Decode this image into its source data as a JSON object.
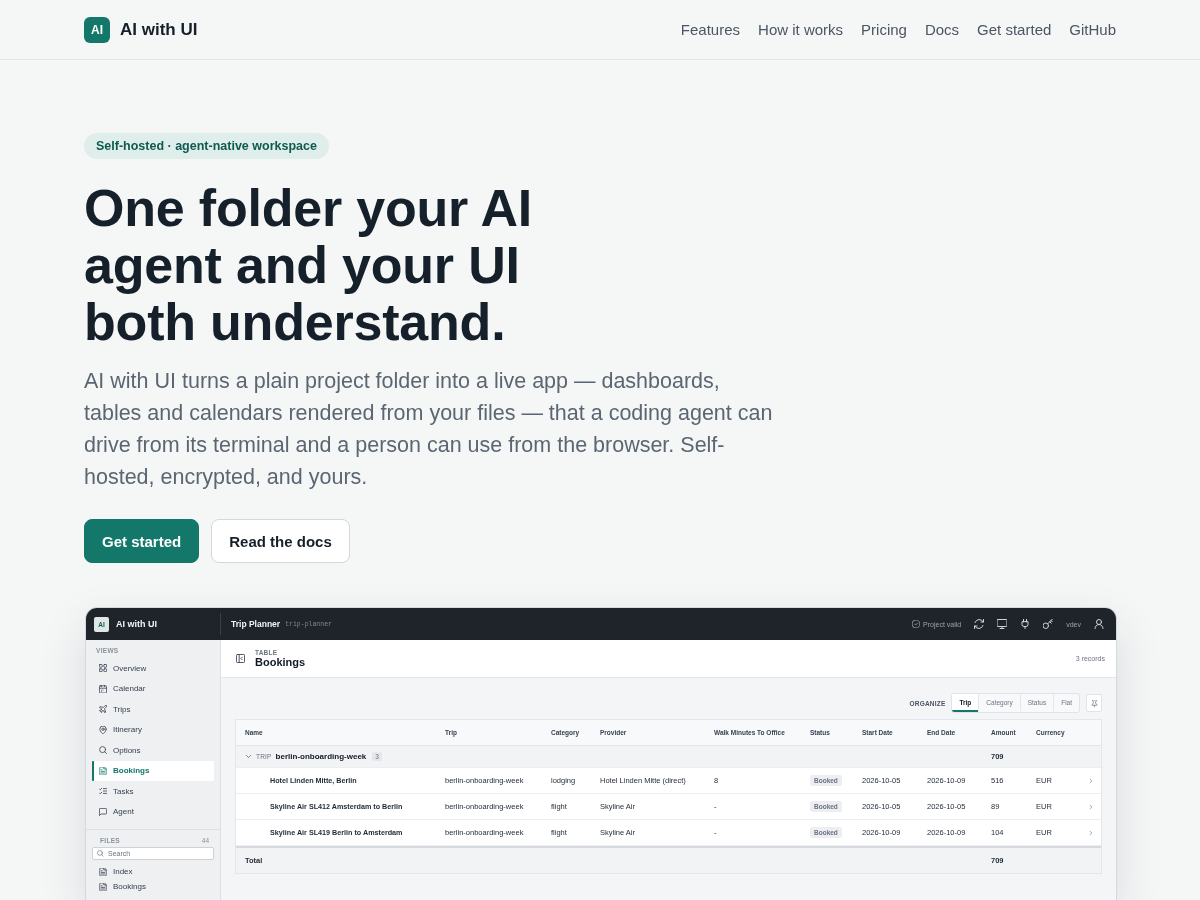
{
  "nav": {
    "logo": "AI",
    "brand": "AI with UI",
    "links": [
      "Features",
      "How it works",
      "Pricing",
      "Docs",
      "Get started",
      "GitHub"
    ]
  },
  "hero": {
    "badge": "Self-hosted · agent-native workspace",
    "headline": "One folder your AI agent and your UI both understand.",
    "description": "AI with UI turns a plain project folder into a live app — dashboards, tables and calendars rendered from your files — that a coding agent can drive from its terminal and a person can use from the browser. Self-hosted, encrypted, and yours.",
    "buttons": [
      {
        "label": "Get started",
        "kind": "primary"
      },
      {
        "label": "Read the docs",
        "kind": "secondary"
      }
    ]
  },
  "app_preview": {
    "header": {
      "logo": "AI",
      "brand": "AI with UI",
      "project": "Trip Planner",
      "project_slug": "trip-planner",
      "status": "Project valid",
      "user": "vdev"
    },
    "sidebar": {
      "views_label": "VIEWS",
      "views": [
        {
          "label": "Overview",
          "selected": false
        },
        {
          "label": "Calendar",
          "selected": false
        },
        {
          "label": "Trips",
          "selected": false
        },
        {
          "label": "Itinerary",
          "selected": false
        },
        {
          "label": "Options",
          "selected": false
        },
        {
          "label": "Bookings",
          "selected": true
        },
        {
          "label": "Tasks",
          "selected": false
        },
        {
          "label": "Agent",
          "selected": false
        }
      ],
      "files_label": "FILES",
      "files_count": "44",
      "search": {
        "placeholder": "Search"
      },
      "files": [
        "Index",
        "Bookings"
      ]
    },
    "content": {
      "kicker": "TABLE",
      "title": "Bookings",
      "record_count": "3 records",
      "organize_label": "ORGANIZE",
      "organize_options": [
        {
          "label": "Trip",
          "selected": true
        },
        {
          "label": "Category",
          "selected": false
        },
        {
          "label": "Status",
          "selected": false
        },
        {
          "label": "Flat",
          "selected": false
        }
      ],
      "table": {
        "columns": [
          "Name",
          "Trip",
          "Category",
          "Provider",
          "Walk Minutes To Office",
          "Status",
          "Start Date",
          "End Date",
          "Amount",
          "Currency"
        ],
        "group": {
          "label": "TRIP",
          "name": "berlin-onboarding-week",
          "count": "3",
          "amount": "709",
          "expanded": true
        },
        "rows": [
          {
            "name": "Hotel Linden Mitte, Berlin",
            "trip": "berlin-onboarding-week",
            "category": "lodging",
            "provider": "Hotel Linden Mitte (direct)",
            "walk_minutes": "8",
            "status": "Booked",
            "start_date": "2026-10-05",
            "end_date": "2026-10-09",
            "amount": "516",
            "currency": "EUR"
          },
          {
            "name": "Skyline Air SL412 Amsterdam to Berlin",
            "trip": "berlin-onboarding-week",
            "category": "flight",
            "provider": "Skyline Air",
            "walk_minutes": "-",
            "status": "Booked",
            "start_date": "2026-10-05",
            "end_date": "2026-10-05",
            "amount": "89",
            "currency": "EUR"
          },
          {
            "name": "Skyline Air SL419 Berlin to Amsterdam",
            "trip": "berlin-onboarding-week",
            "category": "flight",
            "provider": "Skyline Air",
            "walk_minutes": "-",
            "status": "Booked",
            "start_date": "2026-10-09",
            "end_date": "2026-10-09",
            "amount": "104",
            "currency": "EUR"
          }
        ],
        "total": {
          "label": "Total",
          "amount": "709"
        }
      }
    }
  }
}
